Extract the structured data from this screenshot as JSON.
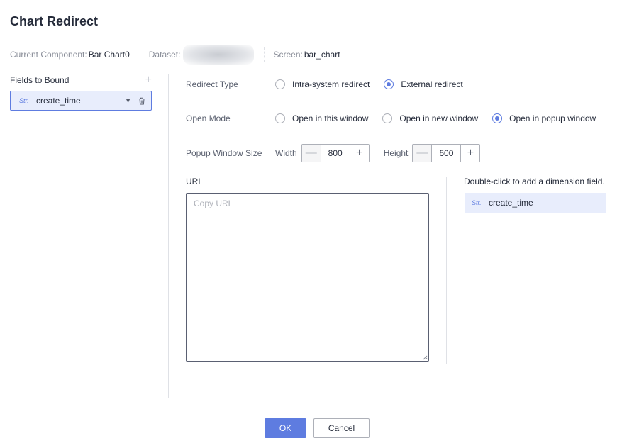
{
  "dialog": {
    "title": "Chart Redirect"
  },
  "info": {
    "component_label": "Current Component:",
    "component_value": "Bar Chart0",
    "dataset_label": "Dataset:",
    "screen_label": "Screen:",
    "screen_value": "bar_chart"
  },
  "fields": {
    "header": "Fields to Bound",
    "add_icon": "plus-icon",
    "items": [
      {
        "tag": "Str.",
        "name": "create_time"
      }
    ]
  },
  "redirect_type": {
    "label": "Redirect Type",
    "options": [
      {
        "label": "Intra-system redirect",
        "checked": false
      },
      {
        "label": "External redirect",
        "checked": true
      }
    ]
  },
  "open_mode": {
    "label": "Open Mode",
    "options": [
      {
        "label": "Open in this window",
        "checked": false
      },
      {
        "label": "Open in new window",
        "checked": false
      },
      {
        "label": "Open in popup window",
        "checked": true
      }
    ]
  },
  "popup_size": {
    "label": "Popup Window Size",
    "width_label": "Width",
    "width_value": "800",
    "height_label": "Height",
    "height_value": "600"
  },
  "url": {
    "label": "URL",
    "placeholder": "Copy URL",
    "value": ""
  },
  "dimension": {
    "hint": "Double-click to add a dimension field.",
    "items": [
      {
        "tag": "Str.",
        "name": "create_time"
      }
    ]
  },
  "footer": {
    "ok_label": "OK",
    "cancel_label": "Cancel"
  },
  "colors": {
    "accent": "#5e7ce0",
    "selected_bg": "#e8edfc",
    "border": "#adb0b8"
  }
}
